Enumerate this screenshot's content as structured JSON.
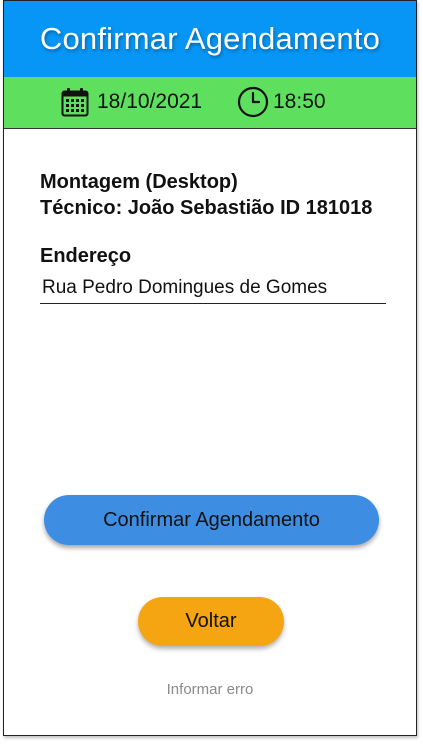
{
  "header": {
    "title": "Confirmar Agendamento",
    "background_color": "#0796f5"
  },
  "schedule": {
    "date": "18/10/2021",
    "time": "18:50",
    "background_color": "#5ee05e",
    "date_icon": "calendar-icon",
    "time_icon": "clock-icon"
  },
  "details": {
    "service": "Montagem (Desktop)",
    "technician": "Técnico: João Sebastião ID 181018",
    "address_label": "Endereço",
    "address_value": "Rua Pedro Domingues de Gomes"
  },
  "actions": {
    "confirm_label": "Confirmar Agendamento",
    "confirm_color": "#3d8ee3",
    "back_label": "Voltar",
    "back_color": "#f5a511",
    "report_error_label": "Informar erro"
  }
}
